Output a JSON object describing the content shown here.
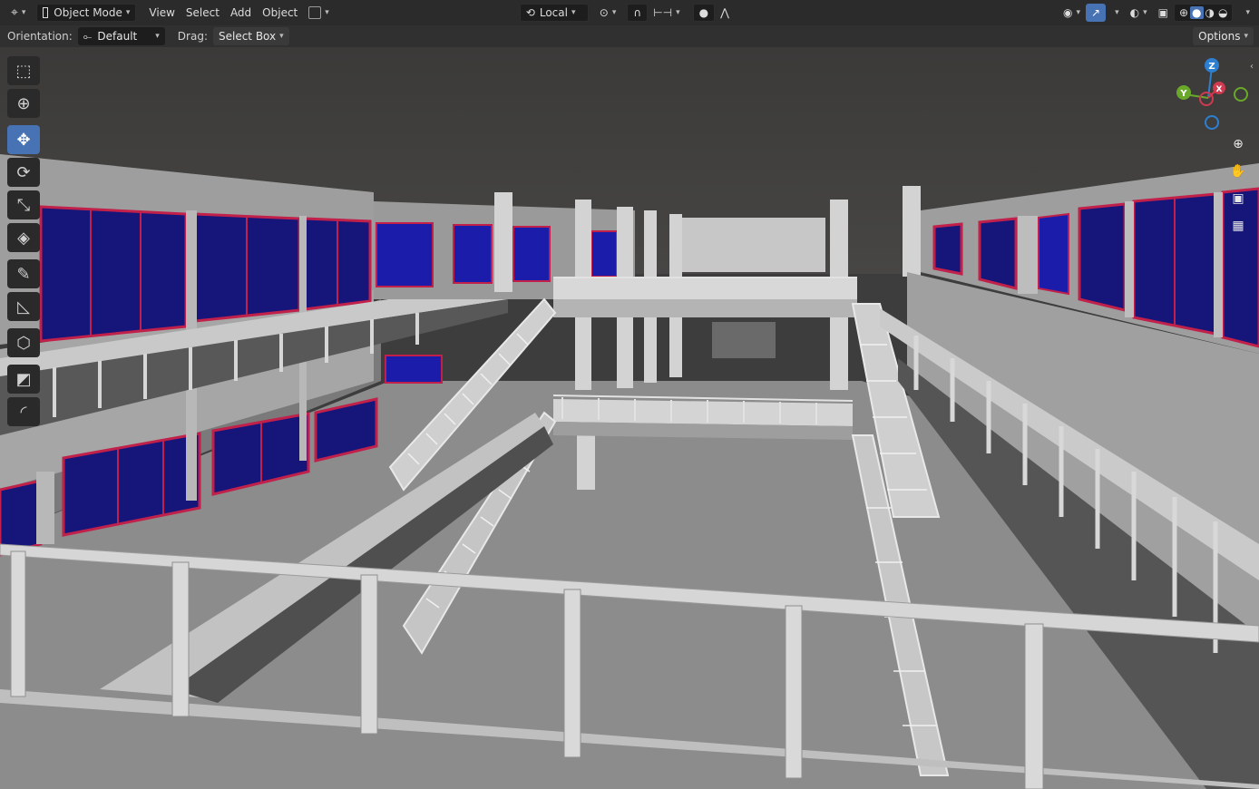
{
  "header": {
    "mode": "Object Mode",
    "menus": [
      "View",
      "Select",
      "Add",
      "Object"
    ],
    "transform_orientation": "Local"
  },
  "tool_header": {
    "orientation_label": "Orientation:",
    "orientation_value": "Default",
    "drag_label": "Drag:",
    "drag_value": "Select Box",
    "options_label": "Options"
  },
  "gizmo": {
    "z": "Z",
    "y": "Y",
    "x": "X"
  },
  "toolbar": {
    "active_tool": "move",
    "tools": [
      "select-box",
      "cursor",
      "move",
      "rotate",
      "scale",
      "transform",
      "annotate",
      "measure",
      "add-cube",
      "inset",
      "bevel"
    ]
  },
  "colors": {
    "active": "#4772b3",
    "window_glass": "#1a1a8a",
    "window_frame": "#c0204a",
    "wall": "#a9a9a9",
    "floor": "#8f8f8f",
    "sky": "#3e3c3b"
  }
}
